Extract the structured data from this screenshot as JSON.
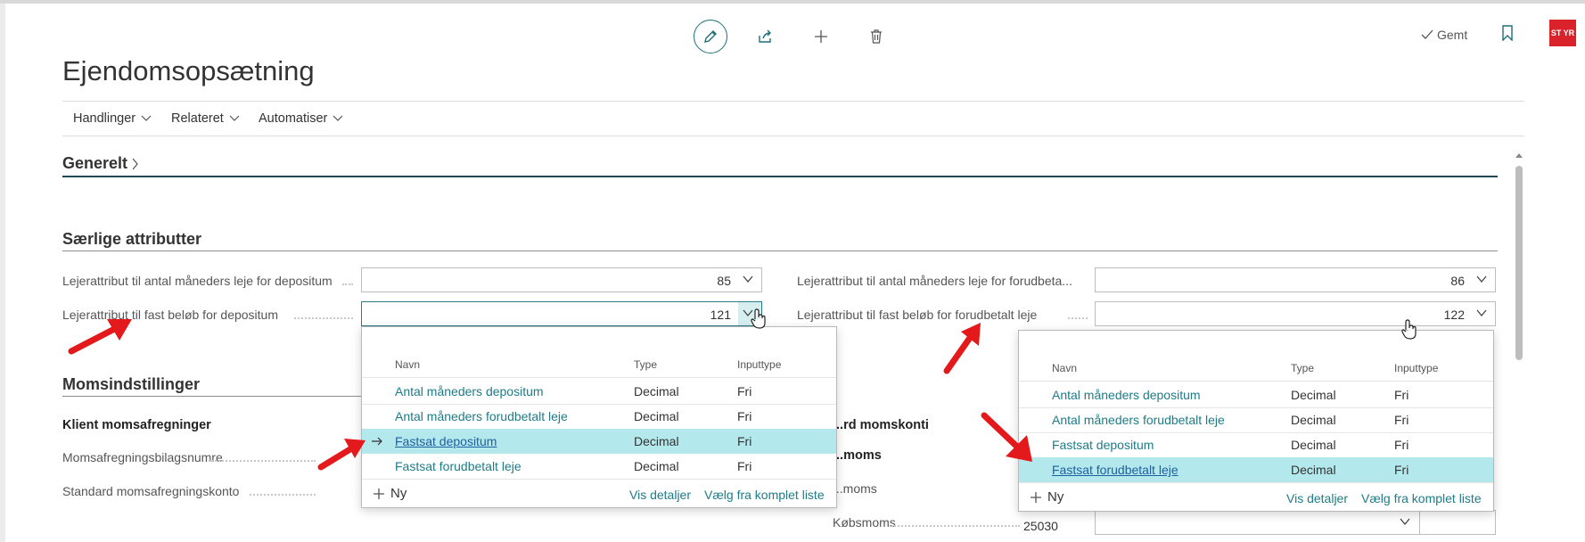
{
  "toolbar": {
    "saved_label": "Gemt",
    "avatar_initials": "ST YR"
  },
  "page": {
    "title": "Ejendomsopsætning"
  },
  "menu": [
    {
      "label": "Handlinger"
    },
    {
      "label": "Relateret"
    },
    {
      "label": "Automatiser"
    }
  ],
  "sections": {
    "general": "Generelt",
    "special": "Særlige attributter",
    "vat": "Momsindstillinger"
  },
  "fields": {
    "deposit_months": {
      "label": "Lejerattribut til antal måneders leje for depositum",
      "value": "85"
    },
    "deposit_fixed": {
      "label": "Lejerattribut til fast beløb for depositum",
      "value": "121"
    },
    "prepaid_months": {
      "label": "Lejerattribut til antal måneders leje for forudbeta...",
      "value": "86"
    },
    "prepaid_fixed": {
      "label": "Lejerattribut til fast beløb for forudbetalt leje",
      "value": "122"
    }
  },
  "vat": {
    "client_heading": "Klient momsafregninger",
    "numbers_label": "Momsafregningsbilagsnumre",
    "account_label": "Standard momsafregningskonto",
    "standard_heading": "...rd momskonti",
    "moms_label": "...moms",
    "moms2_label": "...moms",
    "purchase_label": "Købsmoms",
    "purchase_value": "25030"
  },
  "dropdown_headers": {
    "name": "Navn",
    "type": "Type",
    "input_type": "Inputtype"
  },
  "dropdown_rows": [
    {
      "name": "Antal måneders depositum",
      "type": "Decimal",
      "input_type": "Fri"
    },
    {
      "name": "Antal måneders forudbetalt leje",
      "type": "Decimal",
      "input_type": "Fri"
    },
    {
      "name": "Fastsat depositum",
      "type": "Decimal",
      "input_type": "Fri"
    },
    {
      "name": "Fastsat forudbetalt leje",
      "type": "Decimal",
      "input_type": "Fri"
    }
  ],
  "dropdown_footer": {
    "new": "Ny",
    "details": "Vis detaljer",
    "full_list": "Vælg fra komplet liste"
  },
  "colors": {
    "accent": "#1e7c87",
    "selected_row": "#b3e8ec",
    "annotation_arrow": "#e3191c"
  }
}
